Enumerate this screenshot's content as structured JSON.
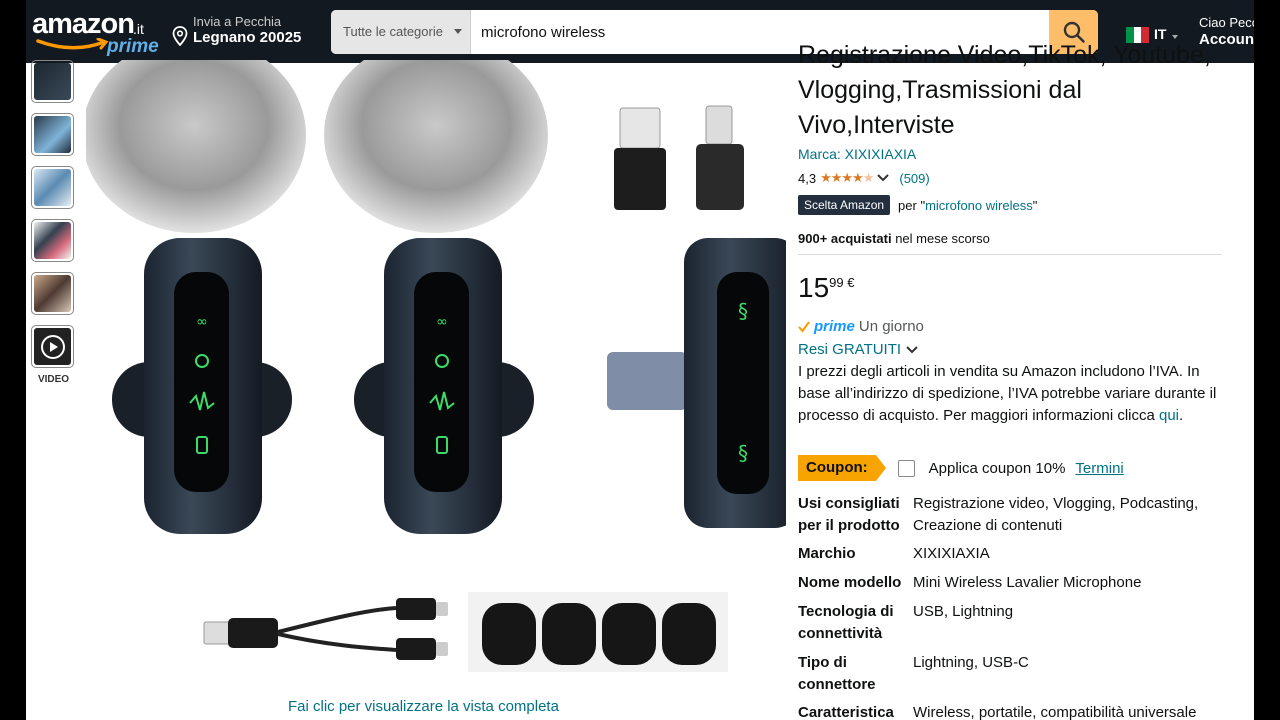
{
  "header": {
    "logo_text": "amazon",
    "logo_tld": ".it",
    "logo_prime": "prime",
    "deliver_line1": "Invia a Pecchia",
    "deliver_line2": "Legnano 20025",
    "search_category": "Tutte le categorie",
    "search_value": "microfono wireless",
    "lang_code": "IT",
    "account_line1": "Ciao Pecchia",
    "account_line2": "Account e liste"
  },
  "gallery": {
    "video_label": "VIDEO",
    "view_full": "Fai clic per visualizzare la vista completa"
  },
  "product": {
    "title": "Registrazione Video,TikTok, Youtube, Vlogging,Trasmissioni dal Vivo,Interviste",
    "brand": "Marca: XIXIXIAXIA",
    "rating_value": "4,3",
    "rating_stars": 4.3,
    "rating_count": "(509)",
    "choice_badge": "Scelta Amazon",
    "choice_prefix": "per \"",
    "choice_keyword": "microfono wireless",
    "choice_suffix": "\"",
    "bought_bold": "900+ acquistati",
    "bought_rest": " nel mese scorso",
    "price_whole": "15",
    "price_fraction": "99 €",
    "prime_label": "prime",
    "prime_delivery": "Un giorno",
    "returns": "Resi GRATUITI",
    "vat_text": "I prezzi degli articoli in vendita su Amazon includono l’IVA. In base all’indirizzo di spedizione, l’IVA potrebbe variare durante il processo di acquisto. Per maggiori informazioni clicca ",
    "vat_link": "qui",
    "vat_end": ".",
    "coupon_tag": "Coupon:",
    "coupon_text": "Applica coupon 10%",
    "coupon_terms": "Termini"
  },
  "specs": [
    {
      "key": "Usi consigliati per il prodotto",
      "value": "Registrazione video, Vlogging, Podcasting, Creazione di contenuti"
    },
    {
      "key": "Marchio",
      "value": "XIXIXIAXIA"
    },
    {
      "key": "Nome modello",
      "value": "Mini Wireless Lavalier Microphone"
    },
    {
      "key": "Tecnologia di connettività",
      "value": "USB, Lightning"
    },
    {
      "key": "Tipo di connettore",
      "value": "Lightning, USB-C"
    },
    {
      "key": "Caratteristica",
      "value": "Wireless, portatile, compatibilità universale"
    }
  ],
  "colors": {
    "header_bg": "#131921",
    "search_button": "#febd69",
    "link": "#007185",
    "star": "#de7921",
    "prime": "#1399ff",
    "coupon": "#f7a400",
    "led_green": "#3ddc6a"
  }
}
